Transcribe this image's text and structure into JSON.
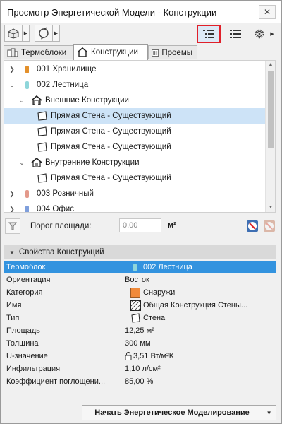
{
  "window": {
    "title": "Просмотр Энергетической Модели - Конструкции",
    "close_glyph": "✕"
  },
  "toolbar": {
    "model_icon": "model-view-icon",
    "refresh_icon": "refresh-icon",
    "list_tree_icon": "tree-list-icon",
    "list_flat_icon": "flat-list-icon",
    "settings_icon": "gear-icon"
  },
  "tabs": [
    {
      "label": "Термоблоки",
      "icon": "thermoblock-icon",
      "active": false
    },
    {
      "label": "Конструкции",
      "icon": "construction-icon",
      "active": true
    },
    {
      "label": "Проемы",
      "icon": "opening-icon",
      "active": false
    }
  ],
  "tree": {
    "rows": [
      {
        "label": "001 Хранилище",
        "expanded": false,
        "swatch": "#e3902b"
      },
      {
        "label": "002 Лестница",
        "expanded": true,
        "swatch": "#8fd6da"
      },
      {
        "label": "Внешние Конструкции",
        "expanded": true,
        "icon": "exterior-house-icon"
      },
      {
        "label": "Прямая Стена - Существующий",
        "icon": "wall-icon",
        "selected": true
      },
      {
        "label": "Прямая Стена - Существующий",
        "icon": "wall-icon"
      },
      {
        "label": "Прямая Стена - Существующий",
        "icon": "wall-icon"
      },
      {
        "label": "Внутренние Конструкции",
        "expanded": true,
        "icon": "interior-house-icon"
      },
      {
        "label": "Прямая Стена - Существующий",
        "icon": "wall-icon"
      },
      {
        "label": "003 Розничный",
        "expanded": false,
        "swatch": "#e3998b"
      },
      {
        "label": "004 Офис",
        "expanded": false,
        "swatch": "#7f9fdc"
      }
    ]
  },
  "filter": {
    "threshold_label": "Порог площади:",
    "threshold_value": "0,00",
    "threshold_unit": "м²"
  },
  "properties": {
    "header": "Свойства Конструкций",
    "rows": [
      {
        "name": "Термоблок",
        "value": "002 Лестница",
        "icon": "swatch",
        "color": "#8fd6da",
        "selected": true
      },
      {
        "name": "Ориентация",
        "value": "Восток"
      },
      {
        "name": "Категория",
        "value": "Снаружи",
        "icon": "category-swatch",
        "color": "#f08a3a"
      },
      {
        "name": "Имя",
        "value": "Общая Конструкция Стены...",
        "icon": "hatch-swatch"
      },
      {
        "name": "Тип",
        "value": "Стена",
        "icon": "wall-icon"
      },
      {
        "name": "Площадь",
        "value": "12,25 м²"
      },
      {
        "name": "Толщина",
        "value": "300 мм"
      },
      {
        "name": "U-значение",
        "value": "3,51 Вт/м²K",
        "icon": "lock-icon"
      },
      {
        "name": "Инфильтрация",
        "value": "1,10 л/см²"
      },
      {
        "name": "Коэффициент поглощени...",
        "value": "85,00 %"
      }
    ]
  },
  "footer": {
    "start_label": "Начать Энергетическое Моделирование"
  }
}
